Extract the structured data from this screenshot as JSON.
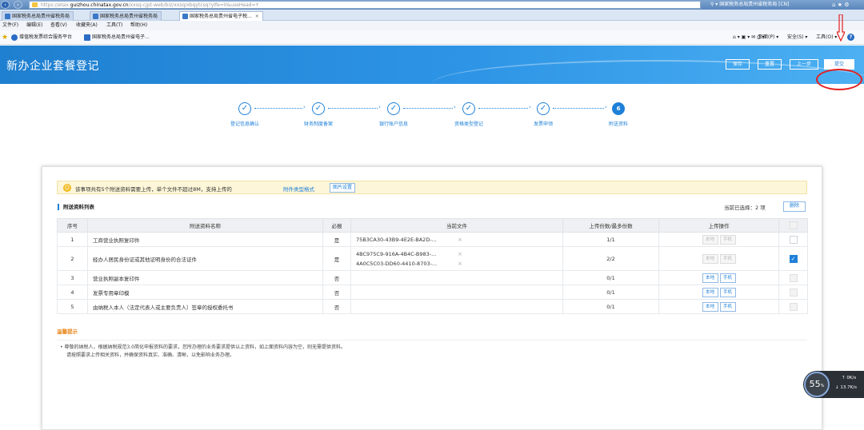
{
  "browser": {
    "url_prefix": "https://etax.",
    "url_domain": "guizhou.chinatax.gov.cn",
    "url_suffix": "/xxsq-cjpt-web/biz/xxsq/xbqytcsq?ylfe=0&useHead=Y",
    "site_identity": "国家税务总局贵州省税务局 [CN]",
    "tabs": [
      {
        "label": "国家税务总局贵州省税务局"
      },
      {
        "label": "国家税务总局贵州省税务局"
      },
      {
        "label": "国家税务总局贵州省电子税...",
        "close": "×"
      }
    ],
    "menu": [
      "文件(F)",
      "编辑(E)",
      "查看(V)",
      "收藏夹(A)",
      "工具(T)",
      "帮助(H)"
    ],
    "favorites": [
      "增值税发票综合服务平台",
      "国家税务总局贵州省电子..."
    ],
    "toolbar": [
      "页面(P) ▾",
      "安全(S) ▾",
      "工具(O) ▾"
    ]
  },
  "header": {
    "title": "新办企业套餐登记",
    "buttons": {
      "save": "保存",
      "reset": "重置",
      "prev": "上一步",
      "submit": "提交"
    }
  },
  "steps": [
    {
      "label": "登记信息确认",
      "state": "done"
    },
    {
      "label": "财务制度备案",
      "state": "done"
    },
    {
      "label": "银行账户信息",
      "state": "done"
    },
    {
      "label": "资格类型登记",
      "state": "done"
    },
    {
      "label": "发票申领",
      "state": "done"
    },
    {
      "label": "附送资料",
      "state": "current",
      "number": "6"
    }
  ],
  "notice": {
    "text": "该事项共有5个附送资料需要上传，单个文件不超过8M，支持上传的",
    "link": "附件类型格式",
    "button": "图片设置"
  },
  "list": {
    "title": "附送资料列表",
    "selected_text": "当前已选择：2 项",
    "delete_button": "删除",
    "columns": [
      "序号",
      "附送资料名称",
      "必报",
      "当前文件",
      "上传份数/最多份数",
      "上传操作",
      ""
    ],
    "upload_local": "本地",
    "upload_phone": "手机",
    "rows": [
      {
        "no": "1",
        "name": "工商营业执照复印件",
        "required": "是",
        "files": [
          "75B3CA30-43B9-4E2E-BA2D-..."
        ],
        "count": "1/1",
        "enabled": false,
        "checked": false
      },
      {
        "no": "2",
        "name": "经办人居民身份证或其他证明身份的合法证件",
        "required": "是",
        "files": [
          "4BC975C9-916A-4B4C-B983-...",
          "4A0C5C03-DD60-4410-8703-..."
        ],
        "count": "2/2",
        "enabled": false,
        "checked": true
      },
      {
        "no": "3",
        "name": "营业执照副本复印件",
        "required": "否",
        "files": [],
        "count": "0/1",
        "enabled": true,
        "checked": false
      },
      {
        "no": "4",
        "name": "发票专用章印模",
        "required": "否",
        "files": [],
        "count": "0/1",
        "enabled": true,
        "checked": false
      },
      {
        "no": "5",
        "name": "由纳税人本人（法定代表人或主要负责人）签章的授权委托书",
        "required": "否",
        "files": [],
        "count": "0/1",
        "enabled": true,
        "checked": false
      }
    ]
  },
  "tips": {
    "title": "温馨提示",
    "line1": "• 尊敬的纳税人，根据纳税规范3.0简化申报资料的要求，您所办理的业务要求提供以上资料，如上面资料内容为空，则无需提供资料。",
    "line2": "请按照要求上传相关资料，并确保资料真实、准确、清晰，以免影响业务办理。"
  },
  "gauge": {
    "value": "55",
    "unit": "%",
    "up": "0K/s",
    "down": "13.7K/s"
  }
}
